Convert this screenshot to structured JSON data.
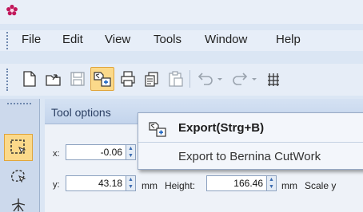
{
  "menubar": {
    "items": [
      "File",
      "Edit",
      "View",
      "Tools",
      "Window",
      "Help"
    ]
  },
  "toolbar": {
    "buttons": [
      {
        "icon": "new-document-icon"
      },
      {
        "icon": "open-folder-icon"
      },
      {
        "icon": "save-icon"
      },
      {
        "icon": "export-icon",
        "active": true
      },
      {
        "icon": "print-icon"
      },
      {
        "icon": "copy-icon"
      },
      {
        "icon": "paste-icon"
      },
      {
        "icon": "undo-icon"
      },
      {
        "icon": "redo-icon"
      },
      {
        "icon": "grid-icon"
      }
    ]
  },
  "tool_options": {
    "title": "Tool options",
    "x_label": "x:",
    "x_value": "-0.06",
    "y_label": "y:",
    "y_value": "43.18",
    "unit_label": "mm",
    "height_label": "Height:",
    "height_value": "166.46",
    "height_unit": "mm",
    "scale_label": "Scale y"
  },
  "tooltip": {
    "title": "Export(Strg+B)",
    "description": "Export to Bernina CutWork"
  },
  "colors": {
    "app_icon": "#c2185b",
    "active_button_fill": "#fbd98a",
    "active_button_border": "#e0a53c"
  }
}
